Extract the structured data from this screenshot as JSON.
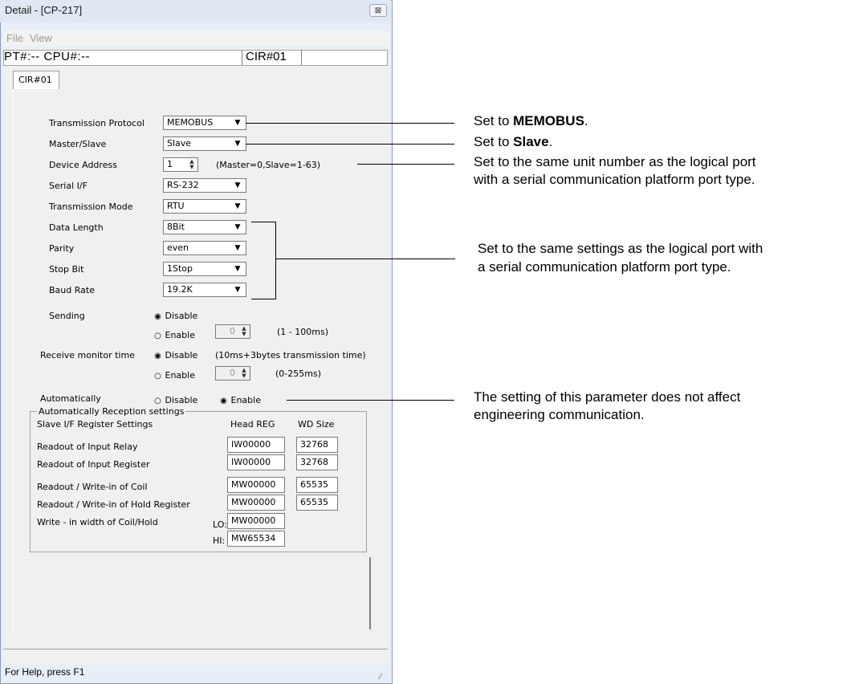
{
  "window": {
    "title": "Detail - [CP-217]",
    "close_glyph": "⊠",
    "menu": [
      "File",
      "View"
    ],
    "pt_cpu": "PT#:-- CPU#:--",
    "cir_field": "CIR#01",
    "tab_label": "CIR#01",
    "status_text": "For Help, press F1",
    "grip_glyph": "⁄⁄"
  },
  "settings": {
    "transmission_protocol": {
      "label": "Transmission Protocol",
      "value": "MEMOBUS"
    },
    "master_slave": {
      "label": "Master/Slave",
      "value": "Slave"
    },
    "device_address": {
      "label": "Device Address",
      "value": "1",
      "hint": "(Master=0,Slave=1-63)"
    },
    "serial_if": {
      "label": "Serial I/F",
      "value": "RS-232"
    },
    "transmission_mode": {
      "label": "Transmission Mode",
      "value": "RTU"
    },
    "data_length": {
      "label": "Data Length",
      "value": "8Bit"
    },
    "parity": {
      "label": "Parity",
      "value": "even"
    },
    "stop_bit": {
      "label": "Stop Bit",
      "value": "1Stop"
    },
    "baud_rate": {
      "label": "Baud Rate",
      "value": "19.2K"
    },
    "sending": {
      "label": "Sending",
      "disable": "Disable",
      "enable": "Enable",
      "value": "0",
      "range": "(1 - 100ms)",
      "selected": "disable"
    },
    "receive_monitor": {
      "label": "Receive monitor time",
      "disable": "Disable",
      "enable": "Enable",
      "note": "(10ms+3bytes transmission time)",
      "value": "0",
      "range": "(0-255ms)",
      "selected": "disable"
    },
    "automatically": {
      "label": "Automatically",
      "disable": "Disable",
      "enable": "Enable",
      "selected": "enable"
    }
  },
  "reception": {
    "group_label": "Automatically Reception settings",
    "slave_if_label": "Slave I/F Register Settings",
    "head_reg_header": "Head REG",
    "wd_size_header": "WD Size",
    "rows": [
      {
        "label": "Readout of Input Relay",
        "head": "IW00000",
        "size": "32768"
      },
      {
        "label": "Readout of Input Register",
        "head": "IW00000",
        "size": "32768"
      },
      {
        "label": "Readout / Write-in of Coil",
        "head": "MW00000",
        "size": "65535"
      },
      {
        "label": "Readout / Write-in of Hold Register",
        "head": "MW00000",
        "size": "65535"
      }
    ],
    "write_width": {
      "label": "Write - in width of Coil/Hold",
      "lo_label": "LO:",
      "lo_value": "MW00000",
      "hi_label": "HI:",
      "hi_value": "MW65534"
    }
  },
  "callouts": {
    "memobus_prefix": "Set to ",
    "memobus_bold": "MEMOBUS",
    "memobus_suffix": ".",
    "slave_prefix": "Set to ",
    "slave_bold": "Slave",
    "slave_suffix": ".",
    "unit_number_1": "Set to the same unit number as the logical port",
    "unit_number_2": "with a serial communication platform port type.",
    "same_settings_1": "Set to the same settings as the logical port with",
    "same_settings_2": "a serial communication platform port type.",
    "auto_1": "The setting of this parameter does not affect",
    "auto_2": "engineering communication."
  }
}
